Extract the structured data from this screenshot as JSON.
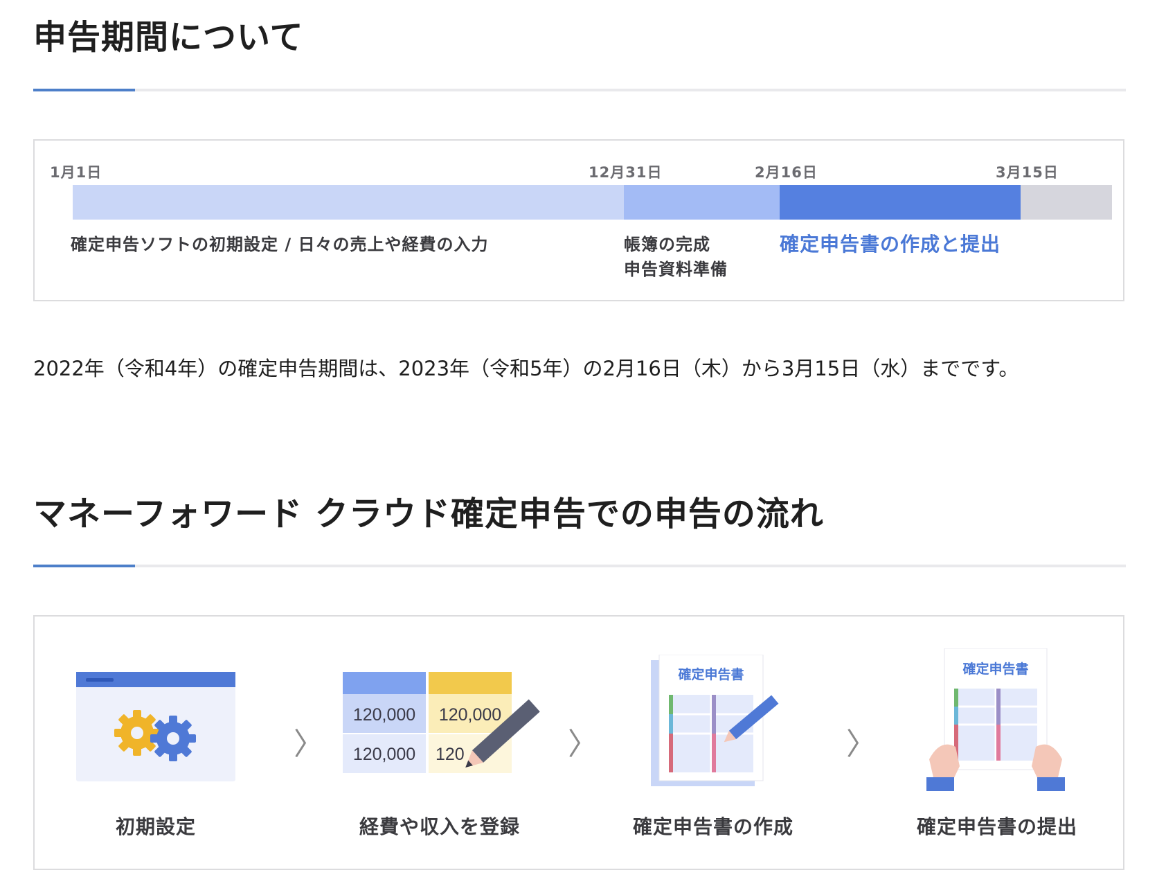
{
  "section1": {
    "title": "申告期間について"
  },
  "timeline": {
    "dates": [
      "1月1日",
      "12月31日",
      "2月16日",
      "3月15日"
    ],
    "labels": {
      "prep": "確定申告ソフトの初期設定 / 日々の売上や経費の入力",
      "books_line1": "帳簿の完成",
      "books_line2": "申告資料準備",
      "filing": "確定申告書の作成と提出"
    },
    "colors": {
      "prep": "#c9d6f7",
      "books": "#a3bbf5",
      "filing": "#5580e0",
      "after": "#d6d6dd"
    }
  },
  "paragraph": "2022年（令和4年）の確定申告期間は、2023年（令和5年）の2月16日（木）から3月15日（水）までです。",
  "section2": {
    "title": "マネーフォワード クラウド確定申告での申告の流れ"
  },
  "flow": {
    "steps": [
      {
        "label": "初期設定",
        "icon": "gear-window-icon"
      },
      {
        "label": "経費や収入を登録",
        "icon": "spreadsheet-pencil-icon"
      },
      {
        "label": "確定申告書の作成",
        "icon": "document-pencil-icon"
      },
      {
        "label": "確定申告書の提出",
        "icon": "document-hands-icon"
      }
    ],
    "cell_values": [
      "120,000",
      "120,000",
      "120,000",
      "120"
    ],
    "doc_title": "確定申告書"
  }
}
